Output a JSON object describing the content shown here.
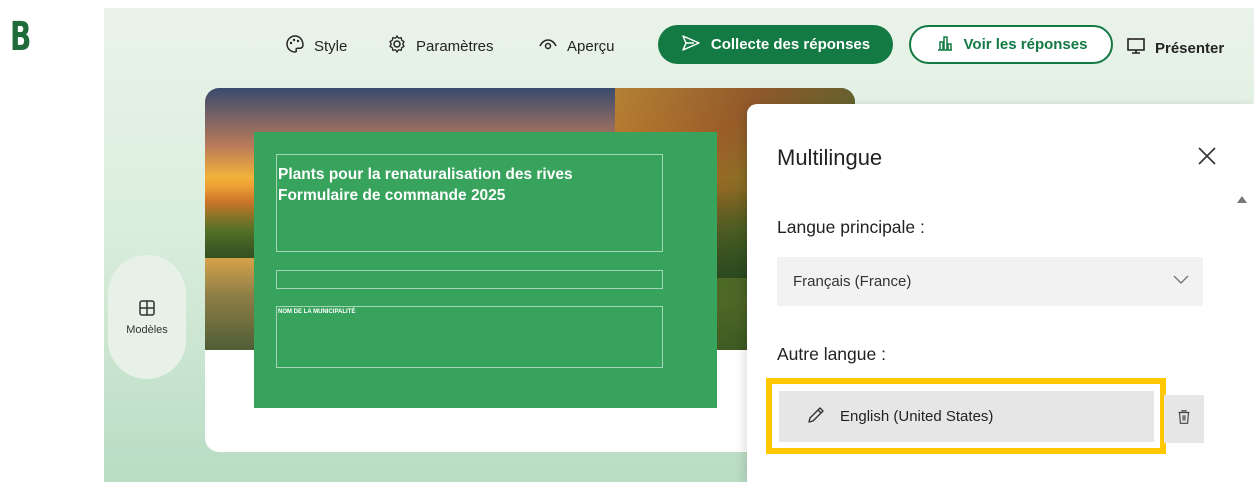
{
  "step_label": "B",
  "toolbar": {
    "style_label": "Style",
    "parametres_label": "Paramètres",
    "apercu_label": "Aperçu",
    "collecte_label": "Collecte des réponses",
    "voir_label": "Voir les réponses",
    "presenter_label": "Présenter"
  },
  "form": {
    "title_line1": "Plants pour la renaturalisation des rives",
    "title_line2": "Formulaire de commande 2025",
    "field_label": "NOM DE LA MUNICIPALITÉ"
  },
  "sidebar": {
    "modeles_label": "Modèles"
  },
  "panel": {
    "title": "Multilingue",
    "primary_language_label": "Langue principale :",
    "primary_language_value": "Français (France)",
    "other_language_label": "Autre langue :",
    "other_languages": [
      "English (United States)"
    ]
  },
  "colors": {
    "brand_green": "#137a43",
    "overlay_green": "#38a35d",
    "highlight": "#ffc800"
  },
  "icons": [
    "palette-icon",
    "gear-icon",
    "eye-icon",
    "send-icon",
    "chart-icon",
    "monitor-icon",
    "templates-icon",
    "close-icon",
    "chevron-down-icon",
    "pencil-icon",
    "trash-icon"
  ]
}
